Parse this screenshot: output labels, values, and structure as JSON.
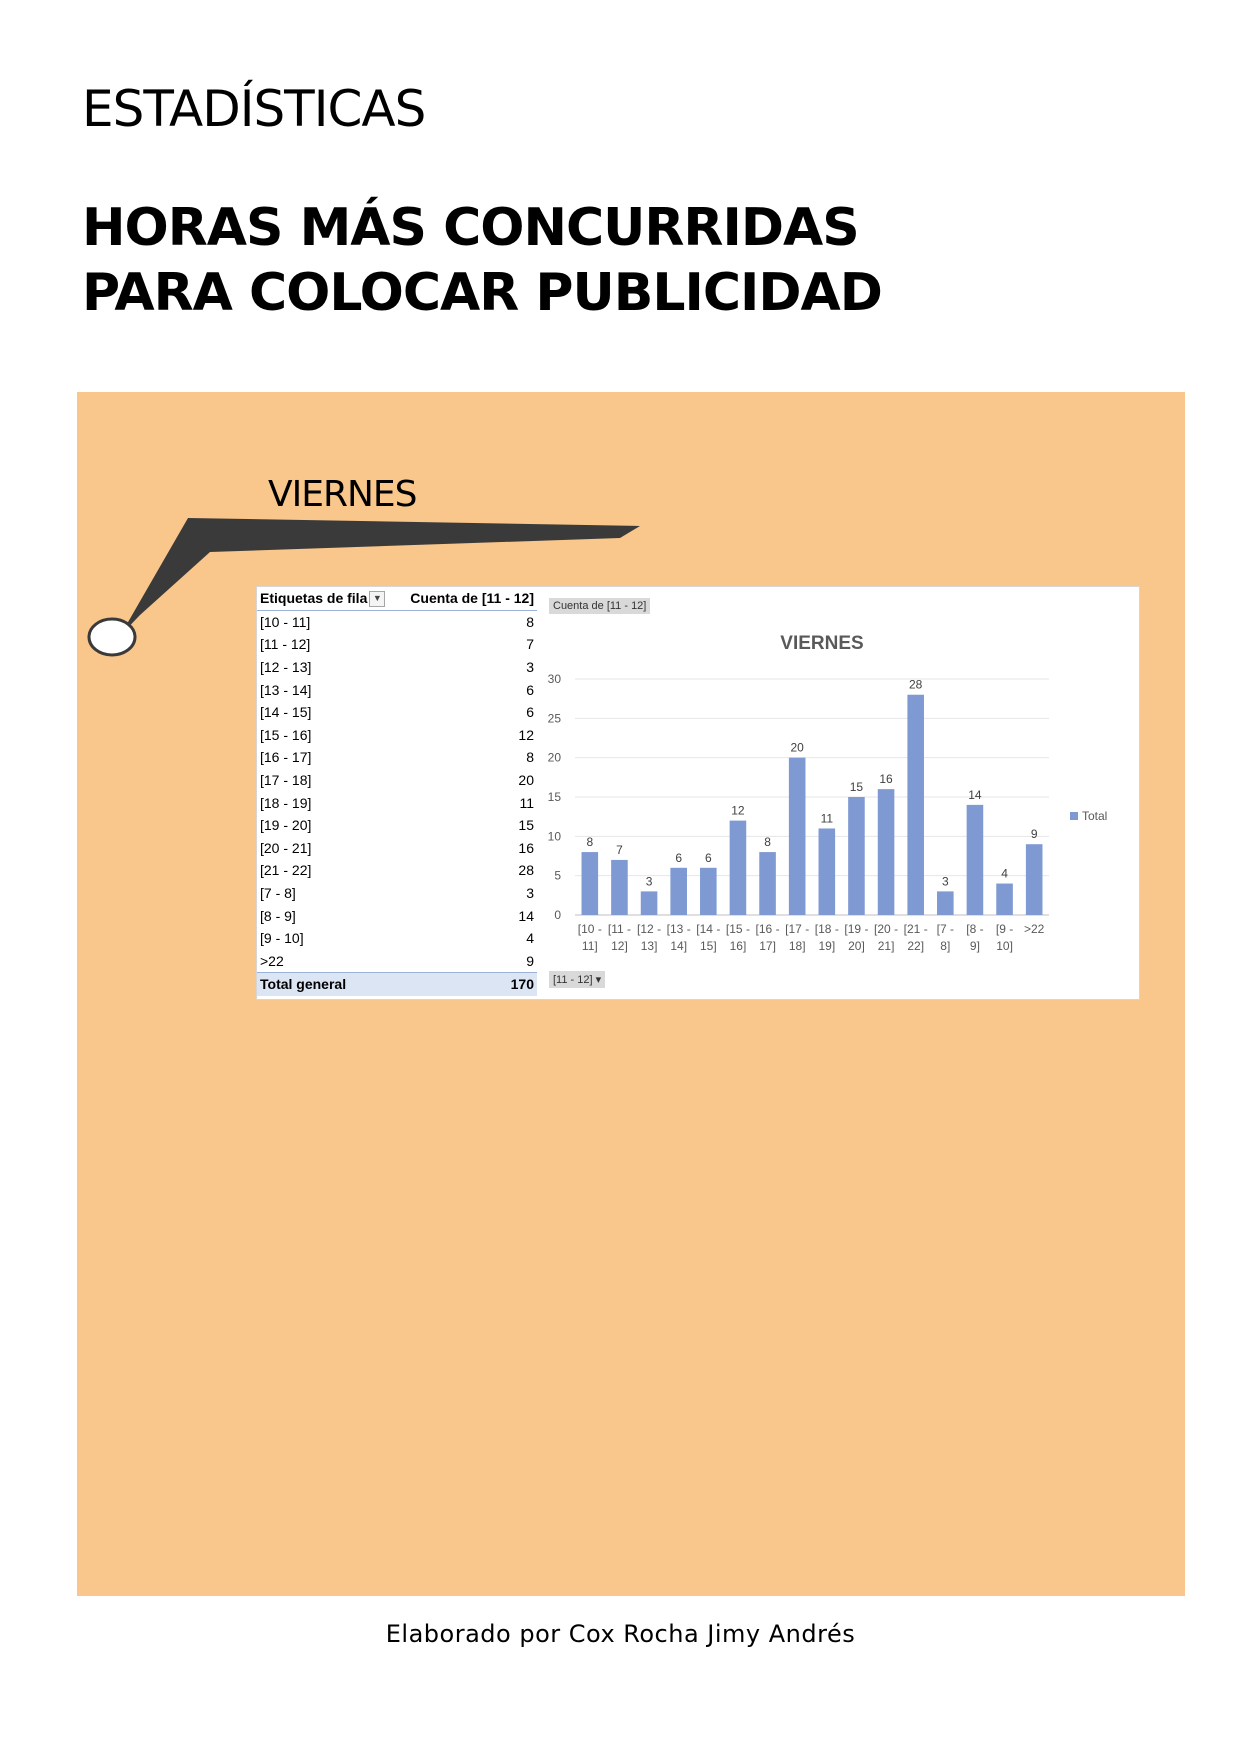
{
  "header": {
    "section_title": "ESTADÍSTICAS",
    "main_title": "HORAS MÁS CONCURRIDAS PARA COLOCAR PUBLICIDAD"
  },
  "day_label": "VIERNES",
  "pivot": {
    "col_labels": "Etiquetas de fila",
    "col_value": "Cuenta de [11 - 12]",
    "rows": [
      {
        "label": "[10 - 11]",
        "value": "8"
      },
      {
        "label": "[11 - 12]",
        "value": "7"
      },
      {
        "label": "[12 - 13]",
        "value": "3"
      },
      {
        "label": "[13 - 14]",
        "value": "6"
      },
      {
        "label": "[14 - 15]",
        "value": "6"
      },
      {
        "label": "[15 - 16]",
        "value": "12"
      },
      {
        "label": "[16 - 17]",
        "value": "8"
      },
      {
        "label": "[17 - 18]",
        "value": "20"
      },
      {
        "label": "[18 - 19]",
        "value": "11"
      },
      {
        "label": "[19 - 20]",
        "value": "15"
      },
      {
        "label": "[20 - 21]",
        "value": "16"
      },
      {
        "label": "[21 - 22]",
        "value": "28"
      },
      {
        "label": "[7 - 8]",
        "value": "3"
      },
      {
        "label": "[8 - 9]",
        "value": "14"
      },
      {
        "label": "[9 - 10]",
        "value": "4"
      },
      {
        "label": ">22",
        "value": "9"
      }
    ],
    "total_label": "Total general",
    "total_value": "170"
  },
  "chart_buttons": {
    "value_field": "Cuenta de [11 - 12]",
    "axis_field": "[11 - 12]"
  },
  "chart_data": {
    "type": "bar",
    "title": "VIERNES",
    "categories": [
      [
        "[10 -",
        "11]"
      ],
      [
        "[11 -",
        "12]"
      ],
      [
        "[12 -",
        "13]"
      ],
      [
        "[13 -",
        "14]"
      ],
      [
        "[14 -",
        "15]"
      ],
      [
        "[15 -",
        "16]"
      ],
      [
        "[16 -",
        "17]"
      ],
      [
        "[17 -",
        "18]"
      ],
      [
        "[18 -",
        "19]"
      ],
      [
        "[19 -",
        "20]"
      ],
      [
        "[20 -",
        "21]"
      ],
      [
        "[21 -",
        "22]"
      ],
      [
        "[7 -",
        "8]"
      ],
      [
        "[8 -",
        "9]"
      ],
      [
        "[9 -",
        "10]"
      ],
      [
        ">22"
      ]
    ],
    "series": [
      {
        "name": "Total",
        "values": [
          8,
          7,
          3,
          6,
          6,
          12,
          8,
          20,
          11,
          15,
          16,
          28,
          3,
          14,
          4,
          9
        ]
      }
    ],
    "ylim": [
      0,
      30
    ],
    "yticks": [
      0,
      5,
      10,
      15,
      20,
      25,
      30
    ],
    "bar_color": "#7f9ad3",
    "legend_position": "right",
    "data_labels": true
  },
  "footer": "Elaborado por Cox Rocha Jimy Andrés",
  "colors": {
    "panel": "#f9c68b",
    "callout": "#3a3a3a"
  }
}
